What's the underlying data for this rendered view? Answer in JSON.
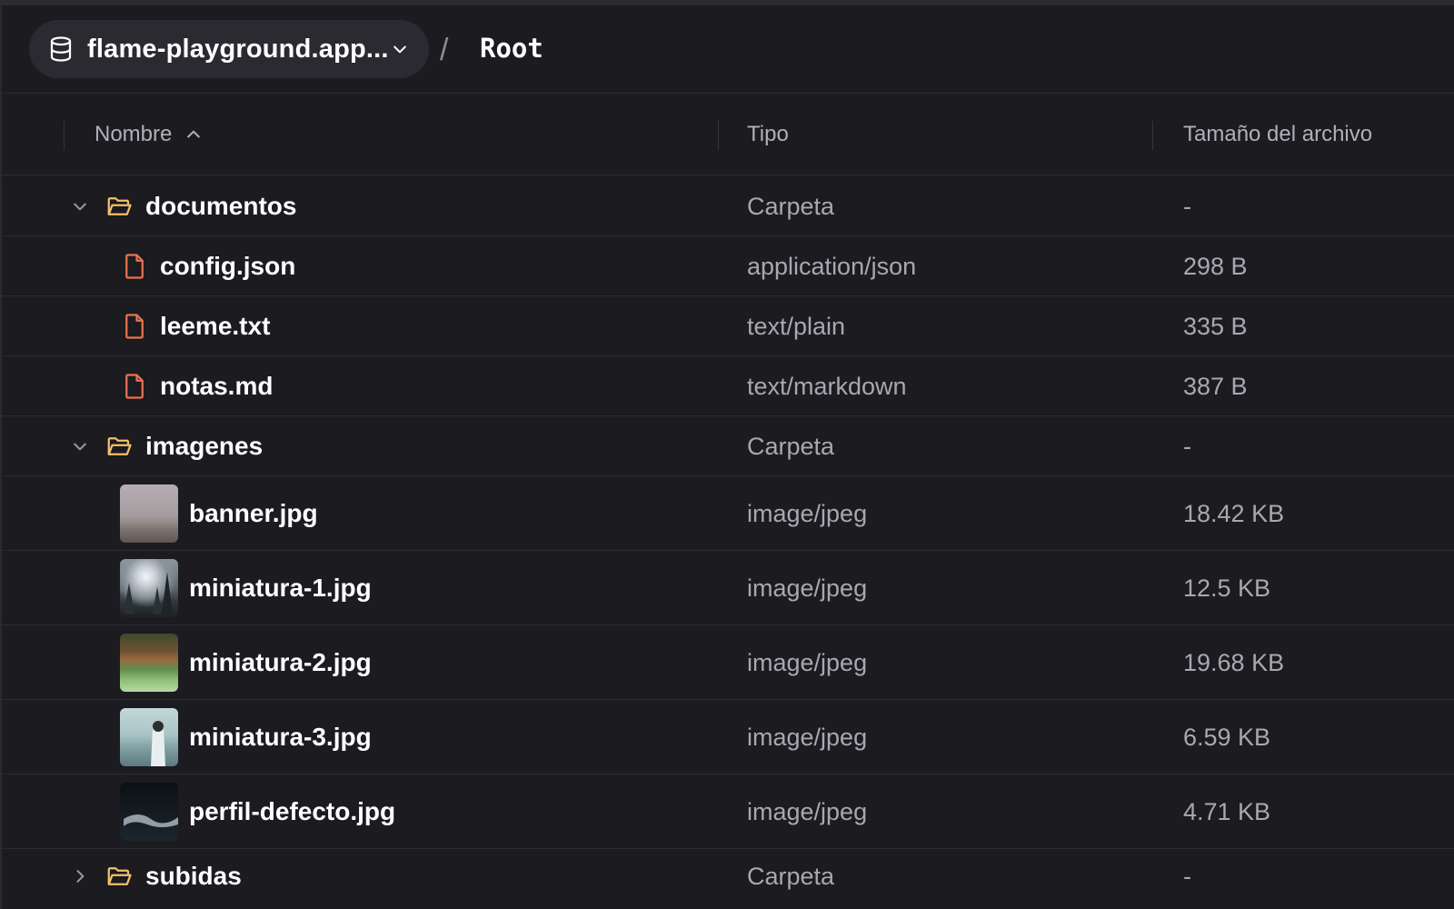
{
  "header": {
    "bucket_name": "flame-playground.app...",
    "separator": "/",
    "breadcrumb": "Root"
  },
  "columns": {
    "name": "Nombre",
    "type": "Tipo",
    "size": "Tamaño del archivo"
  },
  "colors": {
    "background": "#1b1b20",
    "folder_icon": "#f2c16b",
    "file_icon": "#e8734f"
  },
  "rows": [
    {
      "kind": "folder",
      "expanded": true,
      "name": "documentos",
      "type": "Carpeta",
      "size": "-"
    },
    {
      "kind": "file",
      "name": "config.json",
      "type": "application/json",
      "size": "298 B"
    },
    {
      "kind": "file",
      "name": "leeme.txt",
      "type": "text/plain",
      "size": "335 B"
    },
    {
      "kind": "file",
      "name": "notas.md",
      "type": "text/markdown",
      "size": "387 B"
    },
    {
      "kind": "folder",
      "expanded": true,
      "name": "imagenes",
      "type": "Carpeta",
      "size": "-"
    },
    {
      "kind": "image",
      "name": "banner.jpg",
      "type": "image/jpeg",
      "size": "18.42 KB"
    },
    {
      "kind": "image",
      "name": "miniatura-1.jpg",
      "type": "image/jpeg",
      "size": "12.5 KB"
    },
    {
      "kind": "image",
      "name": "miniatura-2.jpg",
      "type": "image/jpeg",
      "size": "19.68 KB"
    },
    {
      "kind": "image",
      "name": "miniatura-3.jpg",
      "type": "image/jpeg",
      "size": "6.59 KB"
    },
    {
      "kind": "image",
      "name": "perfil-defecto.jpg",
      "type": "image/jpeg",
      "size": "4.71 KB"
    },
    {
      "kind": "folder",
      "expanded": false,
      "name": "subidas",
      "type": "Carpeta",
      "size": "-"
    }
  ]
}
